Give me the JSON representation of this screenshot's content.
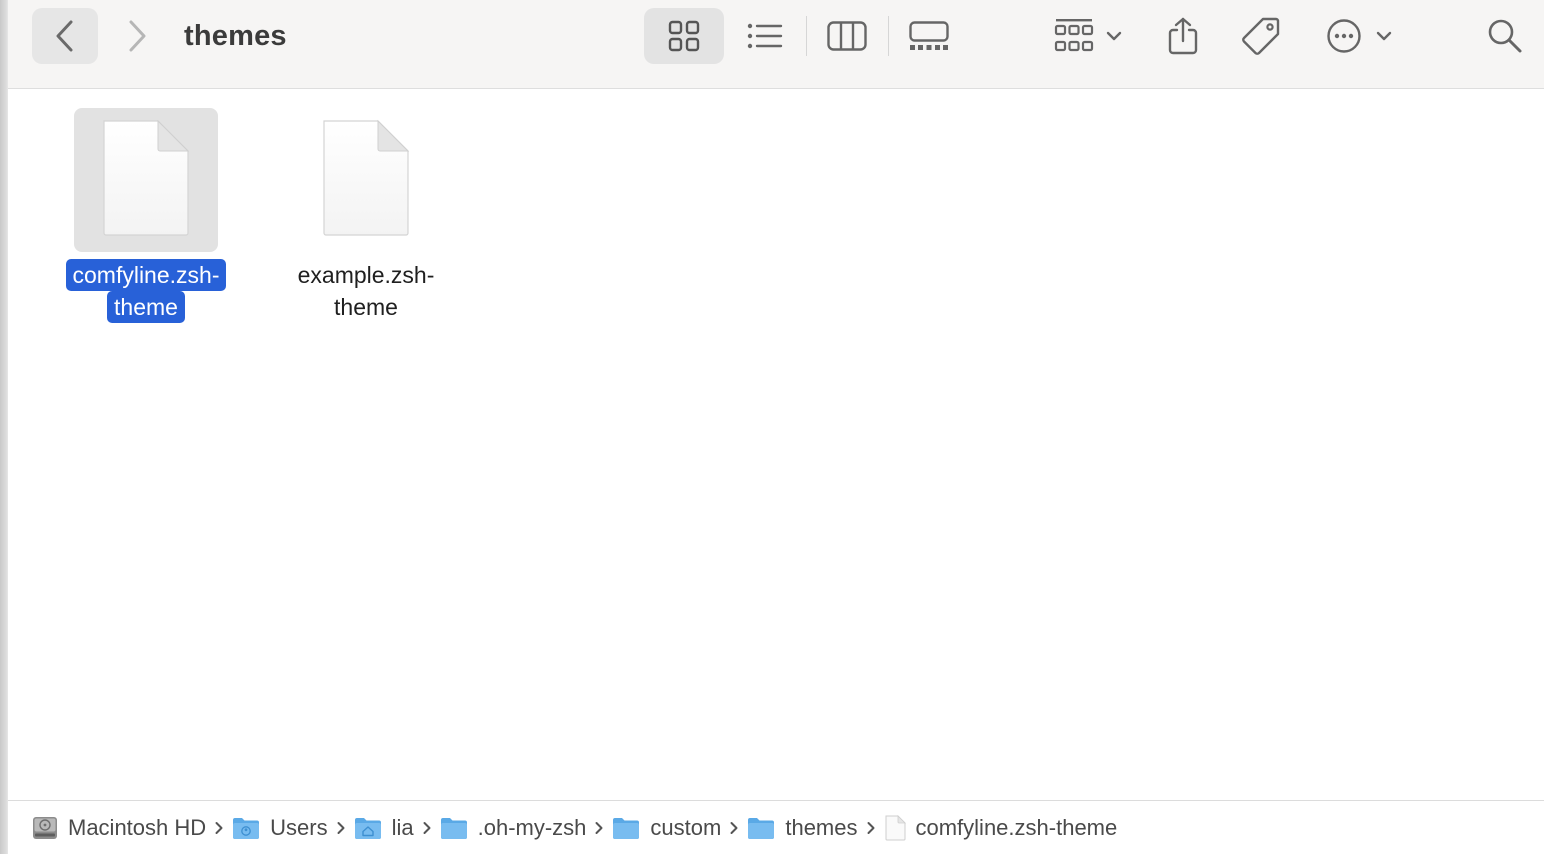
{
  "window": {
    "title": "themes"
  },
  "toolbar": {
    "back_icon": "chevron-left-icon",
    "forward_icon": "chevron-right-icon",
    "buttons": [
      {
        "name": "view-as-icons",
        "icon": "grid-icon",
        "selected": true
      },
      {
        "name": "view-as-list",
        "icon": "list-icon"
      },
      {
        "name": "view-as-columns",
        "icon": "columns-icon"
      },
      {
        "name": "view-as-gallery",
        "icon": "gallery-icon"
      },
      {
        "name": "group",
        "icon": "group-grid-icon"
      },
      {
        "name": "share",
        "icon": "share-icon"
      },
      {
        "name": "tags",
        "icon": "tag-icon"
      },
      {
        "name": "more",
        "icon": "ellipsis-circle-icon"
      },
      {
        "name": "search",
        "icon": "magnifier-icon"
      }
    ]
  },
  "files": [
    {
      "name_line1": "comfyline.zsh-",
      "name_line2": "theme",
      "selected": true,
      "icon": "document-icon"
    },
    {
      "name_line1": "example.zsh-",
      "name_line2": "theme",
      "selected": false,
      "icon": "document-icon"
    }
  ],
  "pathbar": {
    "items": [
      {
        "label": "Macintosh HD",
        "icon": "hard-drive-icon"
      },
      {
        "label": "Users",
        "icon": "users-folder-icon"
      },
      {
        "label": "lia",
        "icon": "home-folder-icon"
      },
      {
        "label": ".oh-my-zsh",
        "icon": "folder-icon"
      },
      {
        "label": "custom",
        "icon": "folder-icon"
      },
      {
        "label": "themes",
        "icon": "folder-icon"
      },
      {
        "label": "comfyline.zsh-theme",
        "icon": "document-icon"
      }
    ]
  },
  "colors": {
    "selection": "#2861d8",
    "toolbar_bg": "#f6f5f4",
    "folder_blue": "#5aa9e6"
  }
}
